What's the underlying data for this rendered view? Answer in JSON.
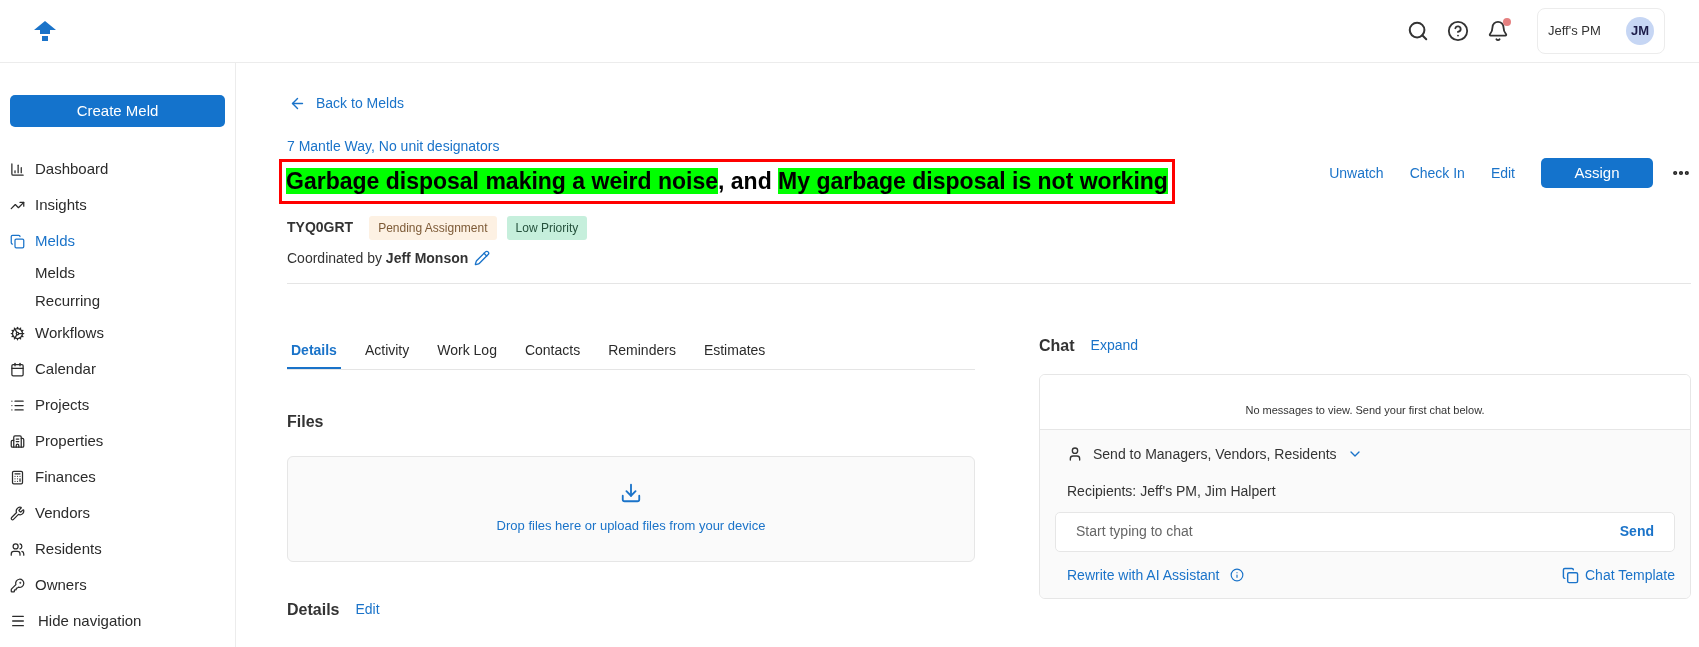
{
  "header": {
    "notifications": {
      "unread": true
    },
    "account": {
      "name": "Jeff's PM",
      "initials": "JM"
    }
  },
  "sidebar": {
    "create_button": "Create Meld",
    "items": [
      {
        "label": "Dashboard",
        "selected": false
      },
      {
        "label": "Insights",
        "selected": false
      },
      {
        "label": "Melds",
        "selected": true,
        "children": [
          {
            "label": "Melds",
            "selected": false
          },
          {
            "label": "Recurring",
            "selected": false
          }
        ]
      },
      {
        "label": "Workflows",
        "selected": false
      },
      {
        "label": "Calendar",
        "selected": false
      },
      {
        "label": "Projects",
        "selected": false
      },
      {
        "label": "Properties",
        "selected": false
      },
      {
        "label": "Finances",
        "selected": false
      },
      {
        "label": "Vendors",
        "selected": false
      },
      {
        "label": "Residents",
        "selected": false
      },
      {
        "label": "Owners",
        "selected": false
      }
    ],
    "hide_navigation": "Hide navigation"
  },
  "meld": {
    "back_link": "Back to Melds",
    "address": "7 Mantle Way, No unit designators",
    "title": {
      "outlined": true,
      "parts": [
        {
          "text": "Garbage disposal making a weird noise",
          "highlighted": true
        },
        {
          "text": ", and ",
          "highlighted": false
        },
        {
          "text": "My garbage disposal is not working",
          "highlighted": true
        }
      ]
    },
    "actions": [
      "Unwatch",
      "Check In",
      "Edit"
    ],
    "assign_button": "Assign",
    "id": "TYQ0GRT",
    "tags": [
      {
        "label": "Pending Assignment",
        "color": "#fdf1e3"
      },
      {
        "label": "Low Priority",
        "color": "#c6efdc"
      }
    ],
    "coordinator": {
      "prefix": "Coordinated by",
      "name": "Jeff Monson"
    }
  },
  "tabs": [
    {
      "label": "Details",
      "selected": true
    },
    {
      "label": "Activity",
      "selected": false
    },
    {
      "label": "Work Log",
      "selected": false
    },
    {
      "label": "Contacts",
      "selected": false
    },
    {
      "label": "Reminders",
      "selected": false
    },
    {
      "label": "Estimates",
      "selected": false
    }
  ],
  "files": {
    "heading": "Files",
    "dropzone": "Drop files here or upload files from your device"
  },
  "details": {
    "heading": "Details",
    "edit": "Edit"
  },
  "chat": {
    "heading": "Chat",
    "expand": "Expand",
    "empty": "No messages to view. Send your first chat below.",
    "send_to": "Send to Managers, Vendors, Residents",
    "recipients": "Recipients: Jeff's PM, Jim Halpert",
    "placeholder": "Start typing to chat",
    "send": "Send",
    "rewrite": "Rewrite with AI Assistant",
    "template": "Chat Template"
  }
}
